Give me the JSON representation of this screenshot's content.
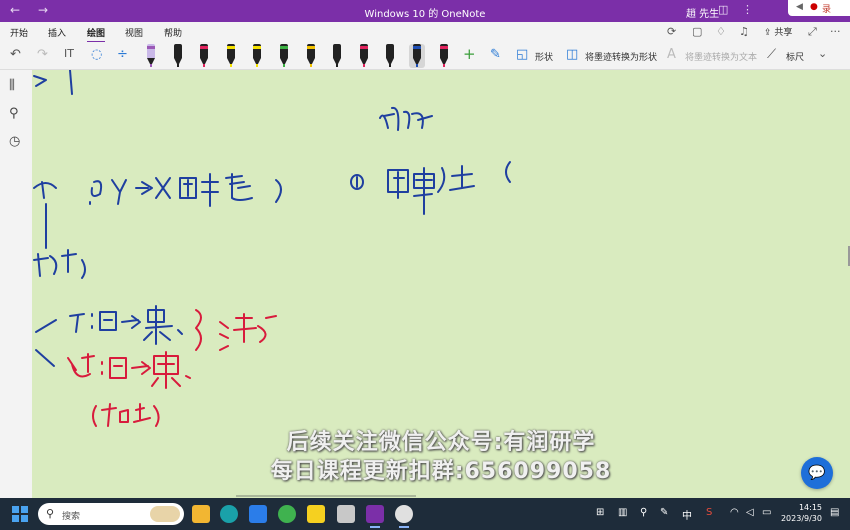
{
  "titlebar": {
    "title": "Windows 10 的 OneNote",
    "user": "趙 先生",
    "back_icon": "←",
    "forward_icon": "→",
    "record_label": "录"
  },
  "tabs": [
    {
      "label": "开始"
    },
    {
      "label": "插入"
    },
    {
      "label": "绘图",
      "active": true
    },
    {
      "label": "视图"
    },
    {
      "label": "帮助"
    }
  ],
  "ribbon_right": {
    "share_label": "共享"
  },
  "toolbar": {
    "undo_icon": "↶",
    "redo_icon": "↷",
    "pens": [
      {
        "color": "#c9b8e8",
        "tip": "#9b59b6"
      },
      {
        "color": "#222222",
        "tip": "#222222"
      },
      {
        "color": "#222222",
        "tip": "#e0245e"
      },
      {
        "color": "#222222",
        "tip": "#f4e100"
      },
      {
        "color": "#222222",
        "tip": "#f4e100"
      },
      {
        "color": "#222222",
        "tip": "#3cb043"
      },
      {
        "color": "#222222",
        "tip": "#f2c200"
      },
      {
        "color": "#222222",
        "tip": "#222222"
      },
      {
        "color": "#222222",
        "tip": "#e0245e"
      },
      {
        "color": "#222222",
        "tip": "#222222"
      },
      {
        "color": "#222222",
        "tip": "#1f4fb5",
        "selected": true
      },
      {
        "color": "#222222",
        "tip": "#e0245e"
      }
    ],
    "add_icon": "+",
    "shapes_label": "形状",
    "ink_to_shape_label": "将墨迹转换为形状",
    "ink_to_text_label": "将墨迹转换为文本",
    "ruler_label": "标尺"
  },
  "subtitles": [
    "后续关注微信公众号:有润研学",
    "每日课程更新扣群:656099058"
  ],
  "fab_icon": "💬",
  "taskbar": {
    "search_placeholder": "搜索",
    "ime_label": "中",
    "time": "14:15",
    "date": "2023/9/30"
  },
  "colors": {
    "accent": "#7b2fa8",
    "canvas": "#d9ebbf",
    "ink_blue": "#1f4fb5",
    "ink_red": "#d81b3c"
  }
}
